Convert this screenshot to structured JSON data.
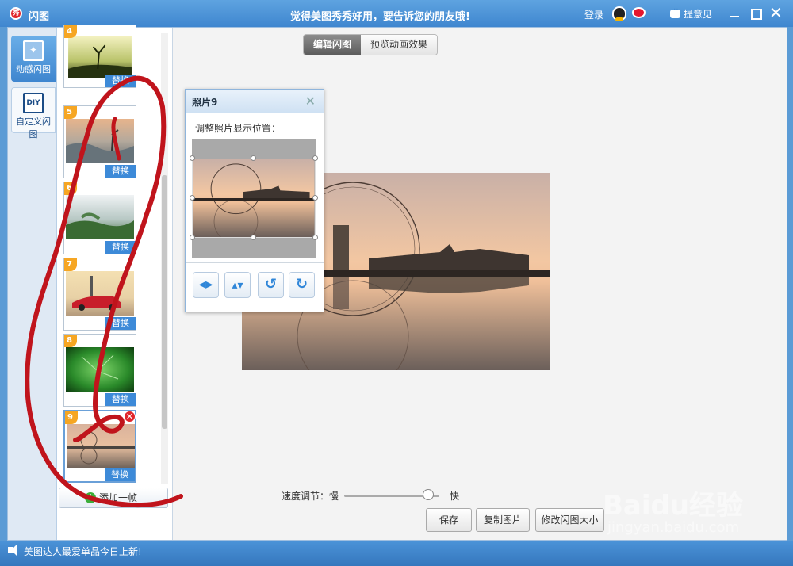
{
  "titlebar": {
    "logo_text": "秀",
    "app_title": "闪图",
    "slogan": "觉得美图秀秀好用，要告诉您的朋友哦!",
    "login": "登录",
    "feedback": "提意见",
    "close_glyph": "✕"
  },
  "nav": {
    "items": [
      {
        "label": "动感闪图",
        "icon": "sparkle-frame-icon"
      },
      {
        "label": "自定义闪图",
        "icon_text": "DIY"
      }
    ]
  },
  "framelist": {
    "frames": [
      {
        "num": "4",
        "replace": "替换"
      },
      {
        "num": "5",
        "replace": "替换"
      },
      {
        "num": "6",
        "replace": "替换"
      },
      {
        "num": "7",
        "replace": "替换"
      },
      {
        "num": "8",
        "replace": "替换"
      },
      {
        "num": "9",
        "replace": "替换",
        "delete_glyph": "✕"
      }
    ],
    "add_frame": "添加一帧"
  },
  "tabs": {
    "edit": "编辑闪图",
    "preview": "预览动画效果"
  },
  "popup": {
    "title": "照片9",
    "label": "调整照片显示位置：",
    "tools": [
      "flip-horizontal-icon",
      "flip-vertical-icon",
      "rotate-left-icon",
      "rotate-right-icon"
    ]
  },
  "controls": {
    "speed_label": "速度调节：慢",
    "fast_label": "快",
    "speed_value": 0.88,
    "save": "保存",
    "copy": "复制图片",
    "resize": "修改闪图大小"
  },
  "statusbar": {
    "text": "美图达人最爱单品今日上新!"
  },
  "watermark": {
    "logo": "Baidu经验",
    "url": "jingyan.baidu.com"
  },
  "colors": {
    "accent": "#3f86cf",
    "annotation": "#c0141c"
  }
}
